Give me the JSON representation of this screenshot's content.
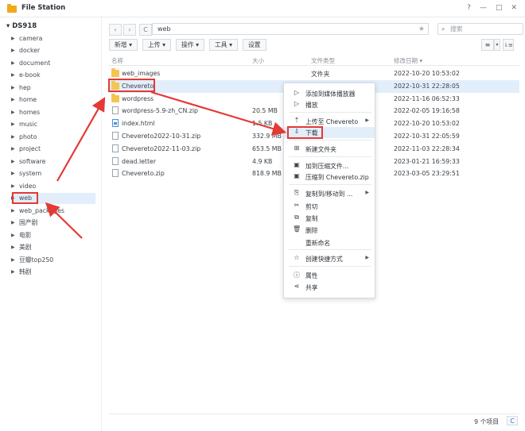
{
  "window": {
    "title": "File Station",
    "help": "?",
    "minimize": "—",
    "maximize": "□",
    "close": "✕"
  },
  "sidebar": {
    "root": "DS918",
    "items": [
      {
        "label": "camera"
      },
      {
        "label": "docker"
      },
      {
        "label": "document"
      },
      {
        "label": "e-book"
      },
      {
        "label": "hep"
      },
      {
        "label": "home"
      },
      {
        "label": "homes"
      },
      {
        "label": "music"
      },
      {
        "label": "photo"
      },
      {
        "label": "project"
      },
      {
        "label": "software"
      },
      {
        "label": "system"
      },
      {
        "label": "video"
      },
      {
        "label": "web"
      },
      {
        "label": "web_packages"
      },
      {
        "label": "国产剧"
      },
      {
        "label": "电影"
      },
      {
        "label": "美剧"
      },
      {
        "label": "豆瓣top250"
      },
      {
        "label": "韩剧"
      }
    ],
    "active_index": 13
  },
  "nav": {
    "back": "‹",
    "forward": "›",
    "refresh": "C",
    "path": "web",
    "star": "★",
    "search_placeholder": "搜索"
  },
  "actions": {
    "create": "新增 ▾",
    "upload": "上传 ▾",
    "operate": "操作 ▾",
    "tools": "工具 ▾",
    "settings": "设置"
  },
  "view": {
    "list": "≡",
    "list_caret": "▾",
    "sort": "⇂≡"
  },
  "columns": {
    "name": "名称",
    "size": "大小",
    "type": "文件类型",
    "modified": "修改日期 ▾"
  },
  "files": [
    {
      "name": "web_images",
      "kind": "folder",
      "size": "",
      "type": "文件夹",
      "modified": "2022-10-20 10:53:02"
    },
    {
      "name": "Chevereto",
      "kind": "folder",
      "size": "",
      "type": "",
      "modified": "2022-10-31 22:28:05",
      "selected": true
    },
    {
      "name": "wordpress",
      "kind": "folder",
      "size": "",
      "type": "",
      "modified": "2022-11-16 06:52:33"
    },
    {
      "name": "wordpress-5.9-zh_CN.zip",
      "kind": "file",
      "size": "20.5 MB",
      "type": "",
      "modified": "2022-02-05 19:16:58"
    },
    {
      "name": "index.html",
      "kind": "html",
      "size": "1.5 KB",
      "type": "",
      "modified": "2022-10-20 10:53:02"
    },
    {
      "name": "Chevereto2022-10-31.zip",
      "kind": "file",
      "size": "332.9 MB",
      "type": "",
      "modified": "2022-10-31 22:05:59"
    },
    {
      "name": "Chevereto2022-11-03.zip",
      "kind": "file",
      "size": "653.5 MB",
      "type": "",
      "modified": "2022-11-03 22:28:34"
    },
    {
      "name": "dead.letter",
      "kind": "file",
      "size": "4.9 KB",
      "type": "",
      "modified": "2023-01-21 16:59:33"
    },
    {
      "name": "Chevereto.zip",
      "kind": "file",
      "size": "818.9 MB",
      "type": "",
      "modified": "2023-03-05 23:29:51"
    }
  ],
  "context_menu": [
    {
      "icon": "play-icon",
      "glyph": "▷",
      "label": "添加到媒体播放器"
    },
    {
      "icon": "play-icon",
      "glyph": "▷",
      "label": "播放"
    },
    {
      "icon": "upload-icon",
      "glyph": "⇡",
      "label": "上传至 Chevereto",
      "submenu": true
    },
    {
      "icon": "download-icon",
      "glyph": "⇩",
      "label": "下载",
      "highlight": true
    },
    {
      "icon": "new-folder-icon",
      "glyph": "⊞",
      "label": "新建文件夹"
    },
    {
      "icon": "compress-icon",
      "glyph": "▣",
      "label": "加到压缩文件..."
    },
    {
      "icon": "compress-icon",
      "glyph": "▣",
      "label": "压缩到 Chevereto.zip"
    },
    {
      "icon": "copy-move-icon",
      "glyph": "⎘",
      "label": "复制到/移动到 ...",
      "submenu": true
    },
    {
      "icon": "cut-icon",
      "glyph": "✂",
      "label": "剪切"
    },
    {
      "icon": "copy-icon",
      "glyph": "⧉",
      "label": "复制"
    },
    {
      "icon": "trash-icon",
      "glyph": "🗑",
      "label": "删除"
    },
    {
      "icon": "",
      "glyph": "",
      "label": "重新命名"
    },
    {
      "icon": "star-icon",
      "glyph": "☆",
      "label": "创建快捷方式",
      "submenu": true
    },
    {
      "icon": "info-icon",
      "glyph": "ⓘ",
      "label": "属性"
    },
    {
      "icon": "share-icon",
      "glyph": "⋖",
      "label": "共享"
    }
  ],
  "footer": {
    "count": "9 个项目",
    "refresh": "C"
  },
  "colors": {
    "highlight_red": "#e53935",
    "selection": "#e3eefb",
    "folder": "#f5c451",
    "accent": "#2a7ad4"
  }
}
